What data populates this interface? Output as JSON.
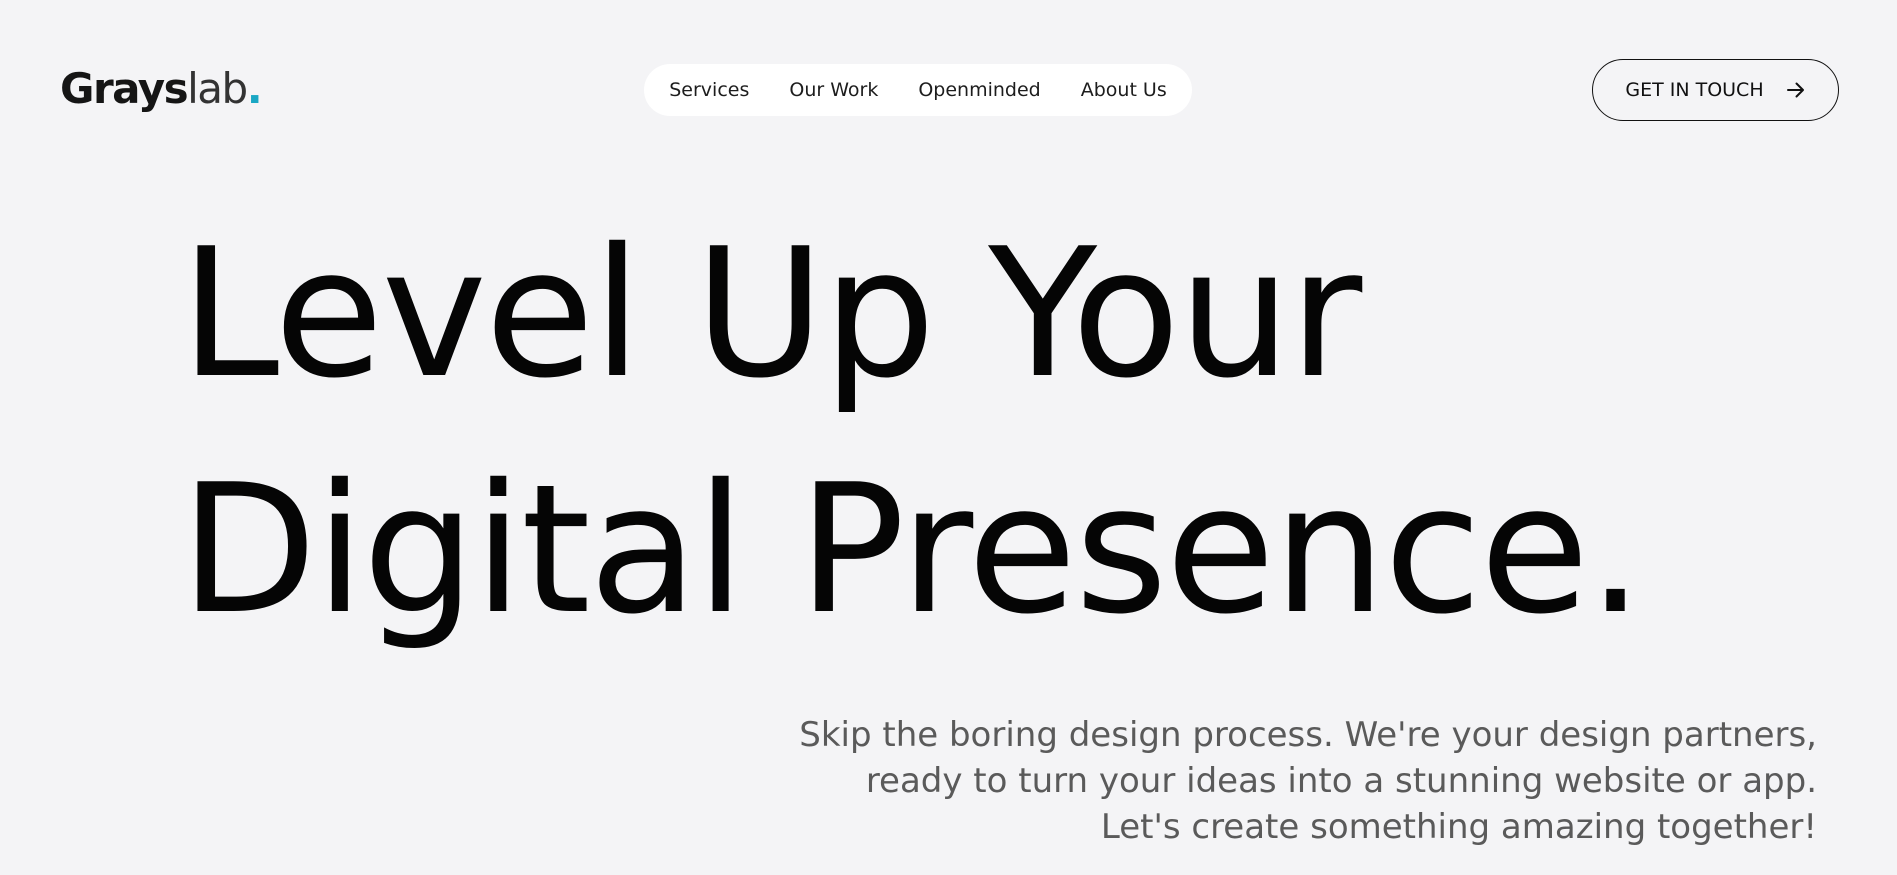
{
  "brand": {
    "name_bold": "Grays",
    "name_light": "lab",
    "dot": ".",
    "dot_color": "#1aa7c4"
  },
  "nav": {
    "items": [
      {
        "label": "Services"
      },
      {
        "label": "Our Work"
      },
      {
        "label": "Openminded"
      },
      {
        "label": "About Us"
      }
    ]
  },
  "cta": {
    "label": "GET IN TOUCH",
    "icon": "arrow-right-icon"
  },
  "hero": {
    "line1": "Level Up Your",
    "line2": "Digital Presence."
  },
  "subtitle": {
    "line1": "Skip the boring design process. We're your design partners,",
    "line2": "ready to turn your ideas into a stunning website or app.",
    "line3": "Let's create something amazing together!"
  },
  "colors": {
    "background": "#f4f4f6",
    "text": "#050505",
    "muted_text": "#5a5a5a",
    "nav_background": "#ffffff"
  }
}
